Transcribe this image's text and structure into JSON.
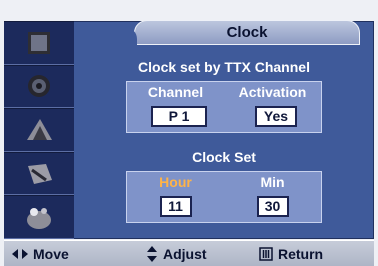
{
  "menu": {
    "title": "Clock"
  },
  "sidebar": {
    "items": [
      {
        "icon": "picture-icon"
      },
      {
        "icon": "sound-icon"
      },
      {
        "icon": "channel-icon"
      },
      {
        "icon": "setup-icon"
      },
      {
        "icon": "input-icon"
      }
    ]
  },
  "ttx": {
    "heading": "Clock set by TTX Channel",
    "col_channel": "Channel",
    "col_activation": "Activation",
    "channel_value": "P  1",
    "activation_value": "Yes"
  },
  "clock_set": {
    "heading": "Clock Set",
    "col_hour": "Hour",
    "col_min": "Min",
    "hour_value": "11",
    "min_value": "30"
  },
  "footer": {
    "move": "Move",
    "adjust": "Adjust",
    "return": "Return"
  },
  "colors": {
    "panel": "#3f5a9a",
    "sidebar": "#1c2a5c",
    "highlight": "#7f93c9",
    "label_accent": "#ffb347"
  }
}
